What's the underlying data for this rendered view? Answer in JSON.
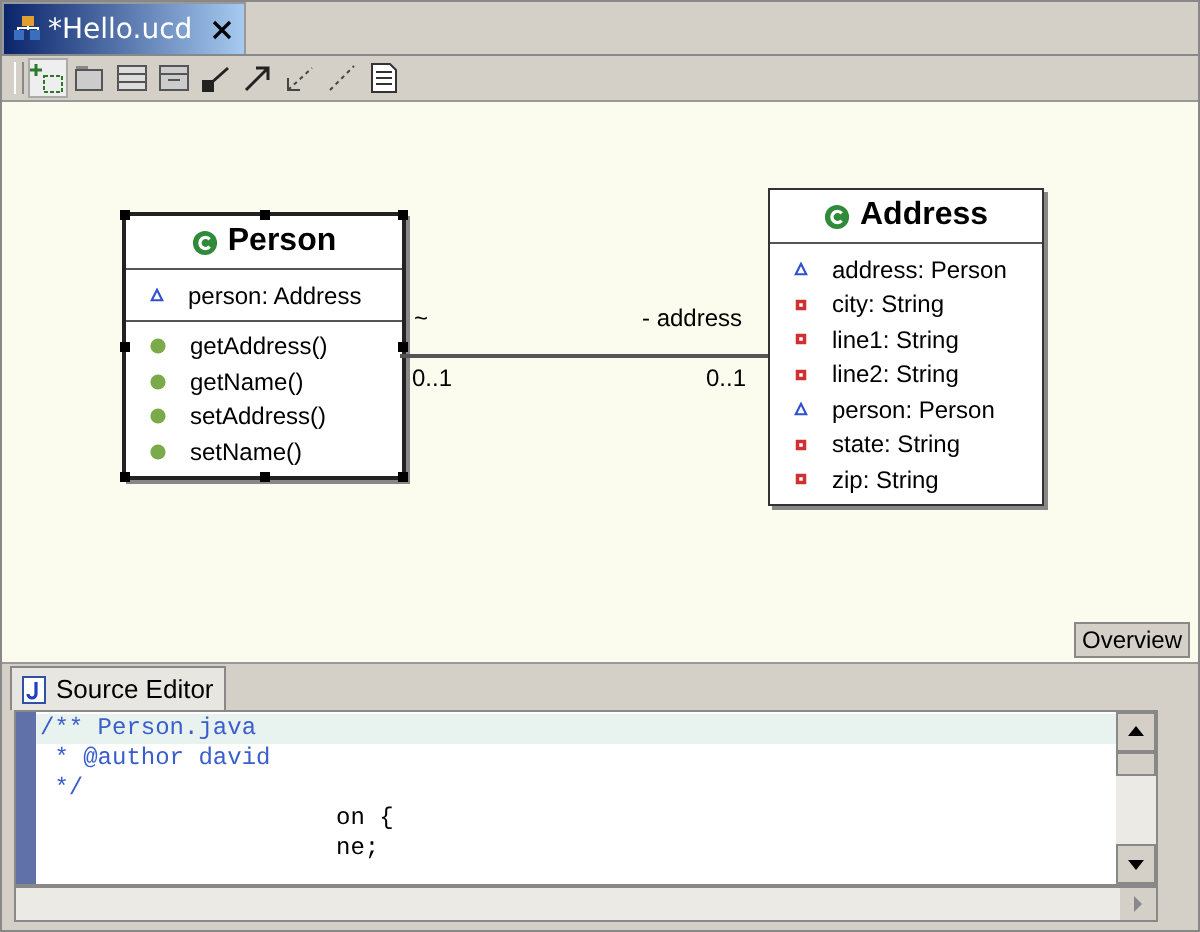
{
  "editor_tab": {
    "title": "*Hello.ucd",
    "selected": true
  },
  "diagram": {
    "classes": [
      {
        "name": "Person",
        "selected": true,
        "attributes": [
          {
            "kind": "package",
            "text": "person: Address"
          }
        ],
        "methods": [
          {
            "kind": "public",
            "text": "getAddress()"
          },
          {
            "kind": "public",
            "text": "getName()"
          },
          {
            "kind": "public",
            "text": "setAddress()"
          },
          {
            "kind": "public",
            "text": "setName()"
          }
        ]
      },
      {
        "name": "Address",
        "selected": false,
        "attributes": [
          {
            "kind": "package",
            "text": "address: Person"
          },
          {
            "kind": "private",
            "text": "city: String"
          },
          {
            "kind": "private",
            "text": "line1: String"
          },
          {
            "kind": "private",
            "text": "line2: String"
          },
          {
            "kind": "package",
            "text": "person: Person"
          },
          {
            "kind": "private",
            "text": "state: String"
          },
          {
            "kind": "private",
            "text": "zip: String"
          }
        ]
      }
    ],
    "association": {
      "source_role": "~",
      "source_multiplicity": "0..1",
      "target_role": "- address",
      "target_multiplicity": "0..1"
    }
  },
  "overview_button": "Overview",
  "source_tab": {
    "title": "Source Editor",
    "selected": true
  },
  "code_lines": [
    {
      "kind": "comment",
      "text": "/** Person.java",
      "current": true
    },
    {
      "kind": "comment",
      "text": " * @author david",
      "current": false
    },
    {
      "kind": "comment",
      "text": " */",
      "current": false
    },
    {
      "kind": "fragment",
      "text": "on {",
      "current": false
    },
    {
      "kind": "fragment",
      "text": "ne;",
      "current": false
    }
  ]
}
